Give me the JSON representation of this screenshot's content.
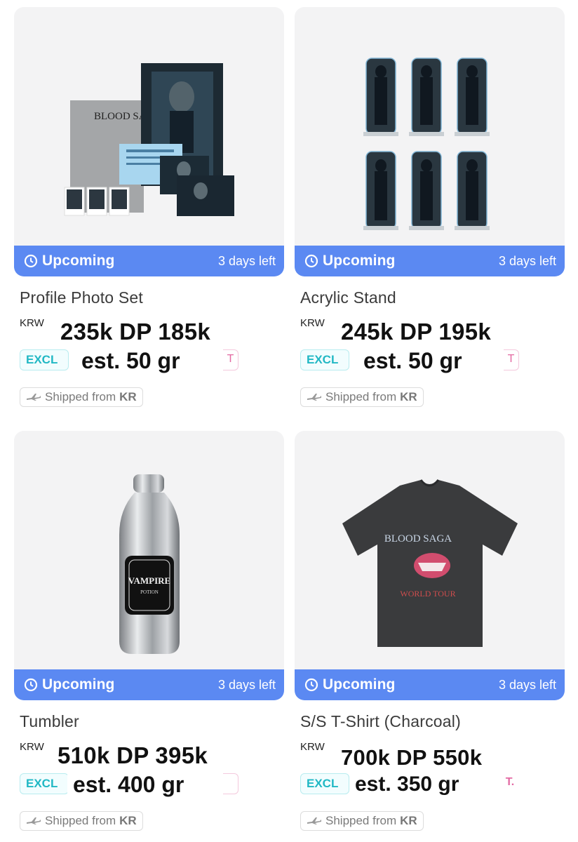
{
  "products": [
    {
      "title": "Profile Photo Set",
      "status": "Upcoming",
      "days_left": "3 days left",
      "currency": "KRW",
      "price": "235k DP 185k",
      "badge": "EXCL",
      "weight": "est. 50 gr",
      "pink_badge": "T",
      "shipped_prefix": "Shipped from",
      "shipped_origin": "KR",
      "image_icon": "photo-set-image"
    },
    {
      "title": "Acrylic Stand",
      "status": "Upcoming",
      "days_left": "3 days left",
      "currency": "KRW",
      "price": "245k DP 195k",
      "badge": "EXCL",
      "weight": "est. 50 gr",
      "pink_badge": "T",
      "shipped_prefix": "Shipped from",
      "shipped_origin": "KR",
      "image_icon": "acrylic-stand-image"
    },
    {
      "title": "Tumbler",
      "status": "Upcoming",
      "days_left": "3 days left",
      "currency": "KRW",
      "price": "510k DP 395k",
      "badge": "EXCL",
      "weight": "est. 400 gr",
      "pink_badge": "",
      "shipped_prefix": "Shipped from",
      "shipped_origin": "KR",
      "image_icon": "tumbler-image"
    },
    {
      "title": "S/S T-Shirt (Charcoal)",
      "status": "Upcoming",
      "days_left": "3 days left",
      "currency": "KRW",
      "price": "700k DP 550k",
      "badge": "EXCL",
      "weight": "est. 350 gr",
      "pink_badge": "T.",
      "shipped_prefix": "Shipped from",
      "shipped_origin": "KR",
      "image_icon": "tshirt-image"
    }
  ],
  "artwork": {
    "photo_set_logo": "BLOOD SAGA",
    "tumbler_label": "VAMPIRE",
    "tumbler_sublabel": "POTION",
    "tshirt_logo": "BLOOD SAGA",
    "tshirt_tour": "WORLD TOUR"
  },
  "colors": {
    "status_bar": "#5b89f2",
    "excl_text": "#21b8c4",
    "pink_badge": "#e36aa3",
    "image_bg": "#f3f3f4"
  }
}
